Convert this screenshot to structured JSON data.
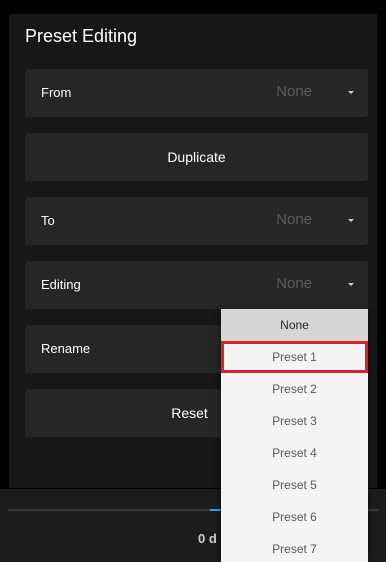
{
  "panel": {
    "title": "Preset Editing"
  },
  "rows": {
    "from": {
      "label": "From",
      "value": "None"
    },
    "duplicate": {
      "label": "Duplicate"
    },
    "to": {
      "label": "To",
      "value": "None"
    },
    "editing": {
      "label": "Editing",
      "value": "None"
    },
    "rename": {
      "label": "Rename"
    },
    "reset": {
      "label": "Reset"
    }
  },
  "bottom": {
    "level_label": "0 d"
  },
  "dropdown": {
    "selected": "None",
    "highlighted": "Preset 1",
    "options": [
      "None",
      "Preset 1",
      "Preset 2",
      "Preset 3",
      "Preset 4",
      "Preset 5",
      "Preset 6",
      "Preset 7"
    ]
  },
  "colors": {
    "accent": "#2aa2e6",
    "highlight_border": "#d6232e"
  }
}
